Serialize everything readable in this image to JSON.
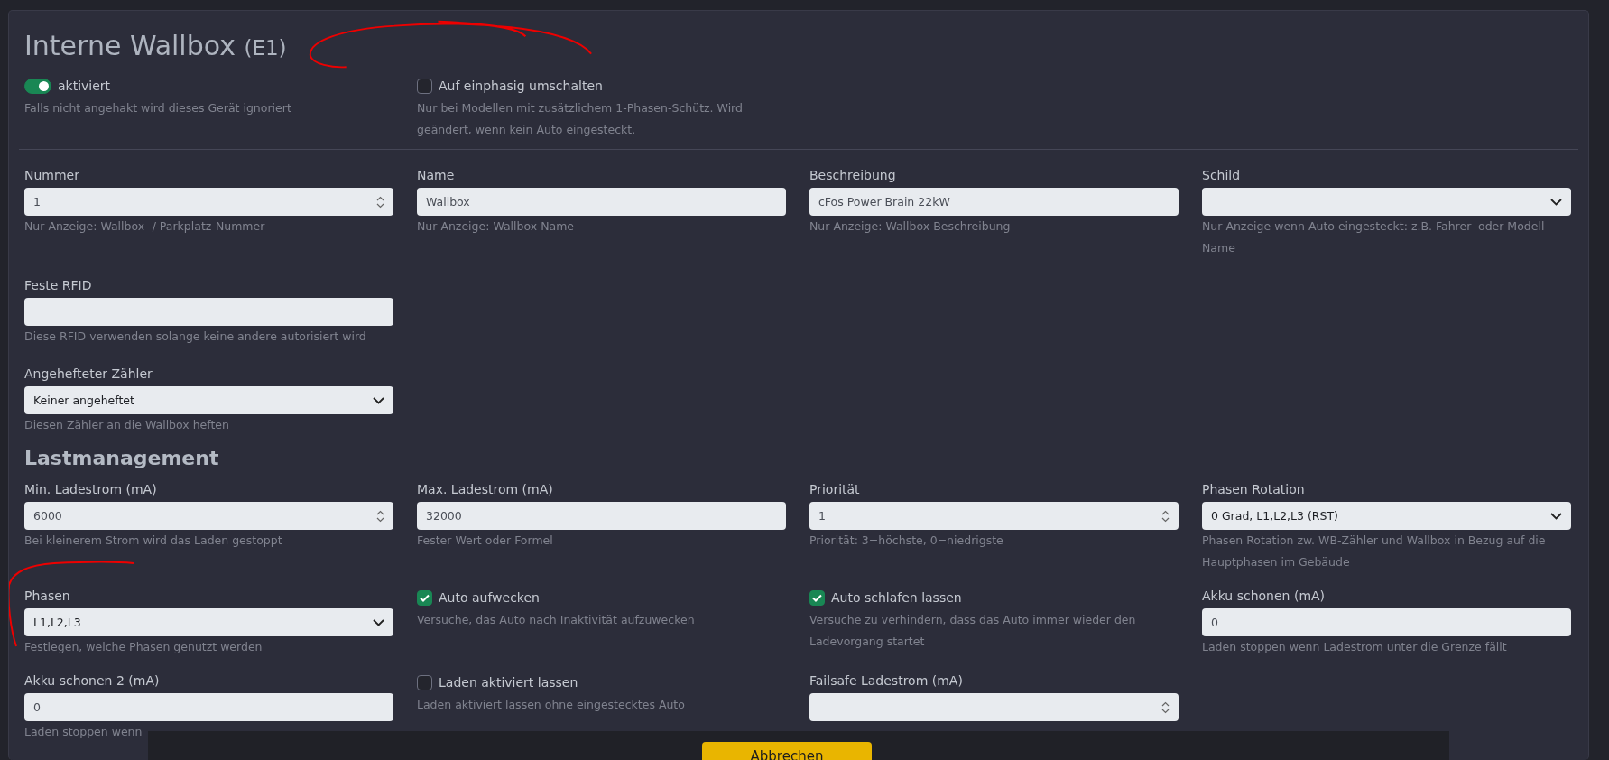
{
  "title": "Interne Wallbox",
  "title_tag": "(E1)",
  "general": [
    {
      "kind": "toggle",
      "label": "aktiviert",
      "on": true,
      "hint": "Falls nicht angehakt wird dieses Gerät ignoriert"
    },
    {
      "kind": "checkbox",
      "label": "Auf einphasig umschalten",
      "checked": false,
      "hint": "Nur bei Modellen mit zusätzlichem 1-Phasen-Schütz. Wird geändert, wenn kein Auto eingesteckt."
    }
  ],
  "rows": [
    [
      {
        "kind": "number",
        "label": "Nummer",
        "value": "1",
        "hint": "Nur Anzeige: Wallbox- / Parkplatz-Nummer"
      },
      {
        "kind": "text",
        "label": "Name",
        "value": "Wallbox",
        "hint": "Nur Anzeige: Wallbox Name"
      },
      {
        "kind": "text",
        "label": "Beschreibung",
        "value": "cFos Power Brain 22kW",
        "hint": "Nur Anzeige: Wallbox Beschreibung"
      },
      {
        "kind": "select",
        "label": "Schild",
        "hint": "Nur Anzeige wenn Auto eingesteckt: z.B. Fahrer- oder Modell-Name"
      }
    ],
    [
      {
        "kind": "text",
        "label": "Feste RFID",
        "hint": "Diese RFID verwenden solange keine andere autorisiert wird"
      }
    ],
    [
      {
        "kind": "select",
        "label": "Angehefteter Zähler",
        "value": "Keiner angeheftet",
        "hint": "Diesen Zähler an die Wallbox heften"
      }
    ]
  ],
  "section": {
    "title": "Lastmanagement",
    "rows": [
      [
        {
          "kind": "number",
          "label": "Min. Ladestrom (mA)",
          "value": "6000",
          "hint": "Bei kleinerem Strom wird das Laden gestoppt"
        },
        {
          "kind": "text",
          "label": "Max. Ladestrom (mA)",
          "value": "32000",
          "hint": "Fester Wert oder Formel"
        },
        {
          "kind": "number",
          "label": "Priorität",
          "value": "1",
          "hint": "Priorität: 3=höchste, 0=niedrigste"
        },
        {
          "kind": "select",
          "label": "Phasen Rotation",
          "value": "0 Grad, L1,L2,L3 (RST)",
          "hint": "Phasen Rotation zw. WB-Zähler und Wallbox in Bezug auf die Hauptphasen im Gebäude"
        }
      ],
      [
        {
          "kind": "select",
          "label": "Phasen",
          "value": "L1,L2,L3",
          "hint": "Festlegen, welche Phasen genutzt werden"
        },
        {
          "kind": "checkbox",
          "label": "Auto aufwecken",
          "checked": true,
          "hint": "Versuche, das Auto nach Inaktivität aufzuwecken"
        },
        {
          "kind": "checkbox",
          "label": "Auto schlafen lassen",
          "checked": true,
          "hint": "Versuche zu verhindern, dass das Auto immer wieder den Ladevorgang startet"
        },
        {
          "kind": "text",
          "label": "Akku schonen (mA)",
          "value": "0",
          "hint": "Laden stoppen wenn Ladestrom unter die Grenze fällt"
        }
      ],
      [
        {
          "kind": "text",
          "label": "Akku schonen 2 (mA)",
          "value": "0",
          "hint": "Laden stoppen wenn"
        },
        {
          "kind": "checkbox",
          "label": "Laden aktiviert lassen",
          "checked": false,
          "hint": "Laden aktiviert lassen ohne eingestecktes Auto"
        },
        {
          "kind": "number",
          "label": "Failsafe Ladestrom (mA)"
        }
      ]
    ]
  },
  "footer": {
    "button": "Abbrechen"
  }
}
